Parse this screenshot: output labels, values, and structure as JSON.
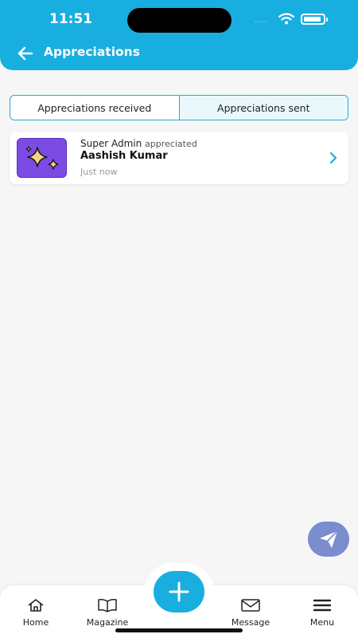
{
  "status_bar": {
    "time": "11:51",
    "signal": "····"
  },
  "header": {
    "title": "Appreciations"
  },
  "tabs": [
    {
      "label": "Appreciations received",
      "active": false
    },
    {
      "label": "Appreciations sent",
      "active": true
    }
  ],
  "appreciations": [
    {
      "from": "Super Admin",
      "verb": "appreciated",
      "to": "Aashish Kumar",
      "time": "Just now",
      "icon": "sparkles-icon"
    }
  ],
  "bottom_nav": [
    {
      "label": "Home",
      "icon": "home-icon"
    },
    {
      "label": "Magazine",
      "icon": "book-icon"
    },
    {
      "label": "Message",
      "icon": "mail-icon"
    },
    {
      "label": "Menu",
      "icon": "hamburger-icon"
    }
  ],
  "colors": {
    "primary": "#18aee0",
    "background": "#f6f6f6",
    "thumb": "#7b4be4",
    "send_fab": "#7b8ccf"
  }
}
